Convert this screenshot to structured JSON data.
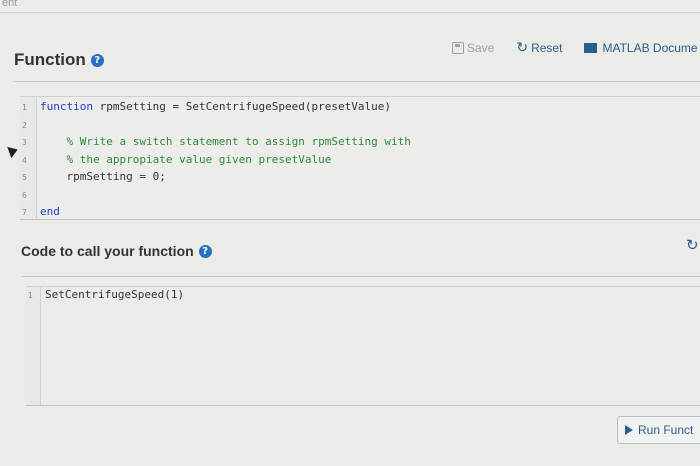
{
  "page": {
    "top_label": "ent"
  },
  "header": {
    "title": "Function",
    "toolbar": {
      "save_label": "Save",
      "reset_label": "Reset",
      "doc_label": "MATLAB Docume"
    }
  },
  "editor": {
    "lines": [
      {
        "n": "1",
        "parts": [
          {
            "t": "function",
            "c": "kw"
          },
          {
            "t": " rpmSetting = SetCentrifugeSpeed(presetValue)",
            "c": ""
          }
        ]
      },
      {
        "n": "2",
        "parts": []
      },
      {
        "n": "3",
        "parts": [
          {
            "t": "    % Write a switch statement to assign rpmSetting with",
            "c": "cm"
          }
        ]
      },
      {
        "n": "4",
        "parts": [
          {
            "t": "    % the appropiate value given presetValue",
            "c": "cm"
          }
        ]
      },
      {
        "n": "5",
        "parts": [
          {
            "t": "    rpmSetting = 0;",
            "c": ""
          }
        ]
      },
      {
        "n": "6",
        "parts": []
      },
      {
        "n": "7",
        "parts": [
          {
            "t": "end",
            "c": "kw"
          }
        ]
      }
    ]
  },
  "call": {
    "title": "Code to call your function",
    "line_number": "1",
    "code": "SetCentrifugeSpeed(1)"
  },
  "run": {
    "label": "Run Funct"
  },
  "colors": {
    "accent": "#2b5d8f",
    "keyword": "#1f3fbf",
    "comment": "#2e8b3a"
  },
  "icons": [
    "help-icon",
    "save-icon",
    "reset-icon",
    "book-icon",
    "refresh-icon",
    "play-icon",
    "cursor-arrow-icon"
  ]
}
